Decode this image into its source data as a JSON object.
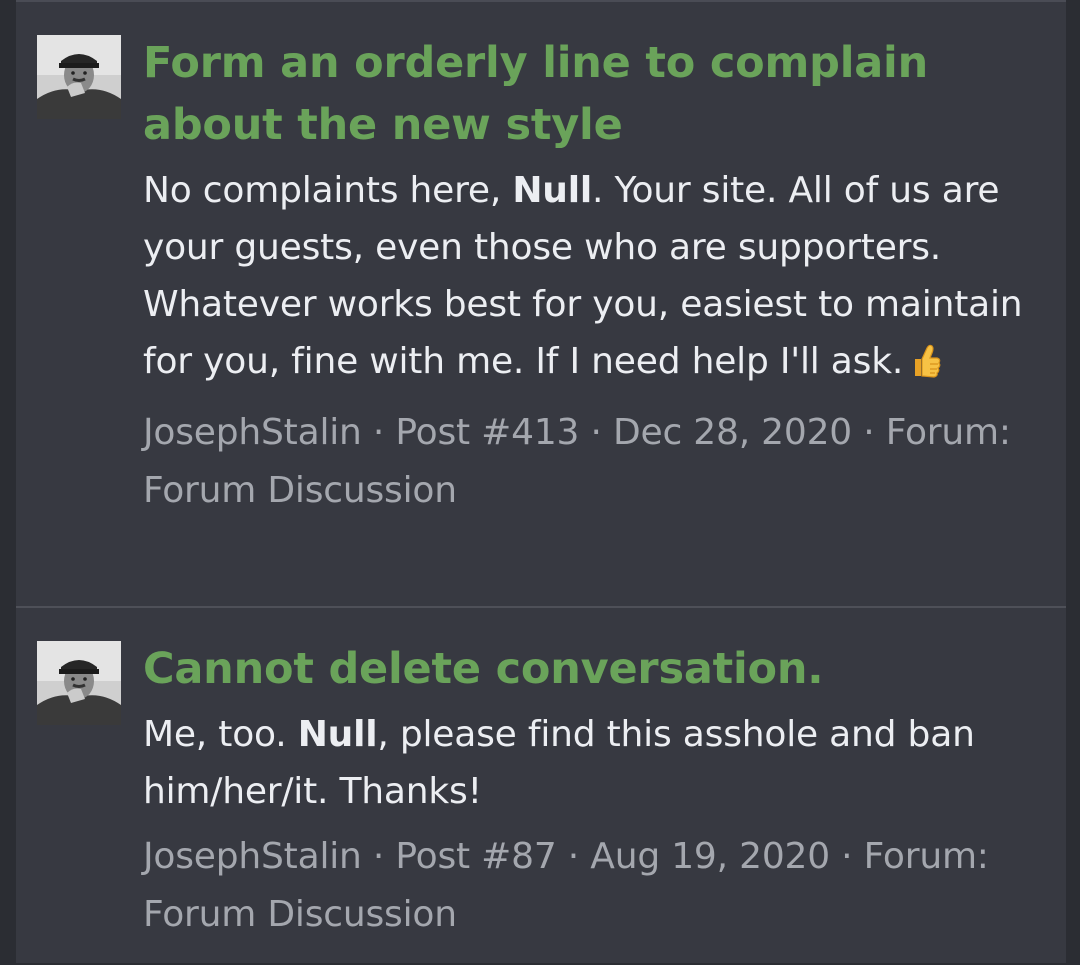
{
  "results": [
    {
      "title": "Form an orderly line to complain about the new style",
      "snippet": {
        "before": "No complaints here, ",
        "highlight": "Null",
        "after": ". Your site. All of us are your guests, even those who are supporters. Whatever works best for you, easiest to maintain for you, fine with me. If I need help I'll ask.",
        "emoji": "thumbs-up-icon"
      },
      "meta": {
        "author": "JosephStalin",
        "sep1": " · ",
        "post": "Post #413",
        "sep2": " · ",
        "date": "Dec 28, 2020",
        "sep3": " · ",
        "forum_prefix": "Forum: ",
        "forum": "Forum Discussion"
      }
    },
    {
      "title": "Cannot delete conversation.",
      "snippet": {
        "before": "Me, too. ",
        "highlight": "Null",
        "after": ", please find this asshole and ban him/her/it. Thanks!"
      },
      "meta": {
        "author": "JosephStalin",
        "sep1": " · ",
        "post": "Post #87",
        "sep2": " · ",
        "date": "Aug 19, 2020",
        "sep3": " · ",
        "forum_prefix": "Forum: ",
        "forum": "Forum Discussion"
      }
    }
  ],
  "colors": {
    "background": "#373941",
    "title": "#6aa35a",
    "text": "#eceef2",
    "meta": "#a4a7ae"
  }
}
